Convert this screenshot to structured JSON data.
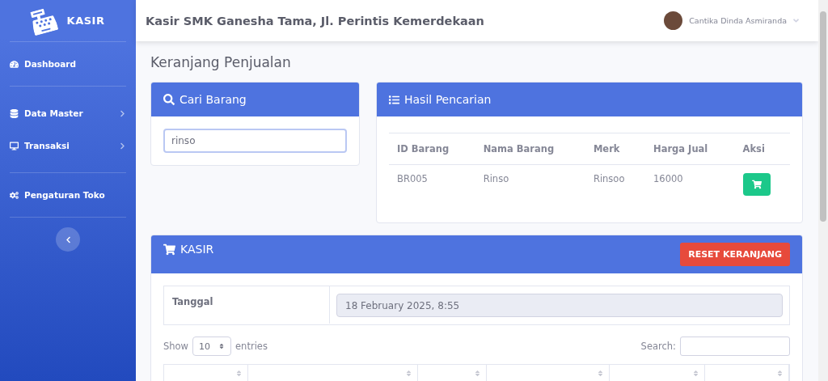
{
  "brand": {
    "name": "KASIR"
  },
  "sidebar": {
    "sections": [
      {
        "items": [
          {
            "label": "Dashboard",
            "kind": "link"
          }
        ]
      },
      {
        "items": [
          {
            "label": "Data Master",
            "kind": "menu"
          },
          {
            "label": "Transaksi",
            "kind": "menu"
          }
        ]
      },
      {
        "items": [
          {
            "label": "Pengaturan Toko",
            "kind": "link"
          }
        ]
      }
    ]
  },
  "topbar": {
    "title": "Kasir SMK Ganesha Tama, Jl. Perintis Kemerdekaan",
    "user": "Cantika Dinda Asmiranda"
  },
  "page_title": "Keranjang Penjualan",
  "search_card": {
    "title": "Cari Barang",
    "value": "rinso"
  },
  "results_card": {
    "title": "Hasil Pencarian",
    "columns": [
      "ID Barang",
      "Nama Barang",
      "Merk",
      "Harga Jual",
      "Aksi"
    ],
    "rows": [
      {
        "id": "BR005",
        "name": "Rinso",
        "brand": "Rinsoo",
        "price": "16000"
      }
    ]
  },
  "kasir_card": {
    "title": "KASIR",
    "reset_button": "RESET KERANJANG",
    "date_label": "Tanggal",
    "date_value": "18 February 2025, 8:55",
    "show_label": "Show",
    "entries_value": "10",
    "entries_label": "entries",
    "search_label": "Search:"
  }
}
